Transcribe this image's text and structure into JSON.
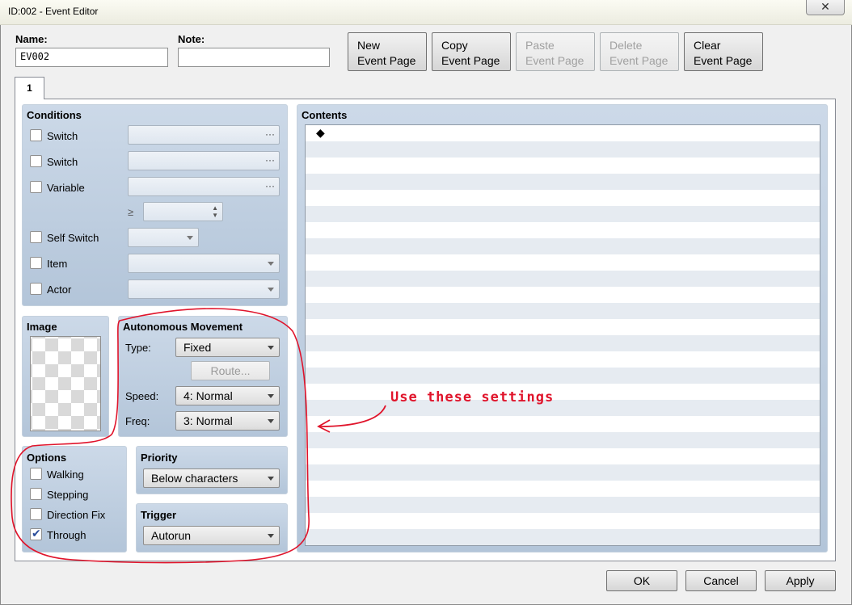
{
  "window": {
    "title": "ID:002 - Event Editor",
    "close_icon": "close-icon"
  },
  "name": {
    "label": "Name:",
    "value": "EV002"
  },
  "note": {
    "label": "Note:",
    "value": ""
  },
  "page_buttons": {
    "new": [
      "New",
      "Event Page"
    ],
    "copy": [
      "Copy",
      "Event Page"
    ],
    "paste": [
      "Paste",
      "Event Page"
    ],
    "delete": [
      "Delete",
      "Event Page"
    ],
    "clear": [
      "Clear",
      "Event Page"
    ]
  },
  "tabs": [
    {
      "label": "1"
    }
  ],
  "conditions": {
    "title": "Conditions",
    "switch1": "Switch",
    "switch2": "Switch",
    "variable": "Variable",
    "gte_symbol": "≥",
    "self_switch": "Self Switch",
    "item": "Item",
    "actor": "Actor",
    "ellipsis": "···"
  },
  "image": {
    "title": "Image"
  },
  "autonomous_movement": {
    "title": "Autonomous Movement",
    "type_label": "Type:",
    "type_value": "Fixed",
    "route_button": "Route...",
    "speed_label": "Speed:",
    "speed_value": "4: Normal",
    "freq_label": "Freq:",
    "freq_value": "3: Normal"
  },
  "options": {
    "title": "Options",
    "walking": "Walking",
    "stepping": "Stepping",
    "direction_fix": "Direction Fix",
    "through": "Through"
  },
  "priority": {
    "title": "Priority",
    "value": "Below characters"
  },
  "trigger": {
    "title": "Trigger",
    "value": "Autorun"
  },
  "contents": {
    "title": "Contents",
    "first_line": "◆"
  },
  "annotation": {
    "text": "Use these settings",
    "color": "#e0142b"
  },
  "footer": {
    "ok": "OK",
    "cancel": "Cancel",
    "apply": "Apply"
  }
}
